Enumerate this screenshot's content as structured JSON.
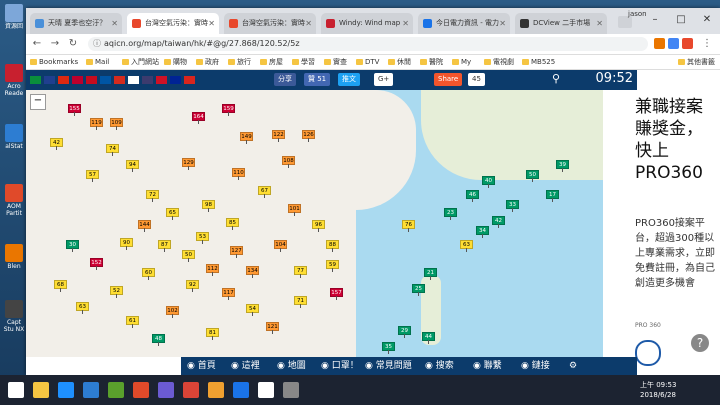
{
  "desktop": {
    "icons": [
      {
        "label": "資源回",
        "color": "#7da7d9"
      },
      {
        "label": "Acro Reade",
        "color": "#c8202f"
      },
      {
        "label": "alStat",
        "color": "#2d7dd2"
      },
      {
        "label": "AOM Partit",
        "color": "#e04a2a"
      },
      {
        "label": "Blen",
        "color": "#ea7600"
      },
      {
        "label": "Capt Stu NX",
        "color": "#444444"
      }
    ]
  },
  "browser": {
    "tabs": [
      {
        "label": "天晴 夏季也空汙？",
        "color": "#4a90d9",
        "active": false
      },
      {
        "label": "台灣空氣污染：實時",
        "color": "#e8482c",
        "active": true
      },
      {
        "label": "台灣空氣污染：實時",
        "color": "#e8482c",
        "active": false
      },
      {
        "label": "Windy: Wind map",
        "color": "#c8202f",
        "active": false
      },
      {
        "label": "今日電力資訊 - 電力",
        "color": "#1a73e8",
        "active": false
      },
      {
        "label": "DCView 二手市場",
        "color": "#333333",
        "active": false
      }
    ],
    "user": "jason",
    "url": "aqicn.org/map/taiwan/hk/#@g/27.868/120.52/5z",
    "bookmarks": [
      "Bookmarks",
      "Mail",
      "入門網站",
      "購物",
      "政府",
      "旅行",
      "房屋",
      "學習",
      "實查",
      "DTV",
      "休閒",
      "醫院",
      "My",
      "電視劇",
      "MB525",
      "其他書籤"
    ]
  },
  "site": {
    "share_label": "分享",
    "fb_label": "贊 51",
    "twitter_label": "推文",
    "gplus_label": "G+",
    "sharethis_label": "Share",
    "share_count": "45",
    "time": "09:52",
    "flags": [
      "#0a8f3c",
      "#1f3f8f",
      "#de2910",
      "#bc002d",
      "#c60b1e",
      "#0055a4",
      "#d52b1e",
      "#ffffff",
      "#3c3b6e",
      "#ce1126",
      "#002395",
      "#da251d"
    ]
  },
  "map": {
    "markers": [
      {
        "v": "155",
        "c": "r"
      },
      {
        "v": "119",
        "c": "o"
      },
      {
        "v": "109",
        "c": "o"
      },
      {
        "v": "42",
        "c": "y"
      },
      {
        "v": "164",
        "c": "r"
      },
      {
        "v": "159",
        "c": "r"
      },
      {
        "v": "122",
        "c": "o"
      },
      {
        "v": "149",
        "c": "o"
      },
      {
        "v": "126",
        "c": "o"
      },
      {
        "v": "74",
        "c": "y"
      },
      {
        "v": "94",
        "c": "y"
      },
      {
        "v": "57",
        "c": "y"
      },
      {
        "v": "129",
        "c": "o"
      },
      {
        "v": "110",
        "c": "o"
      },
      {
        "v": "108",
        "c": "o"
      },
      {
        "v": "144",
        "c": "o"
      },
      {
        "v": "90",
        "c": "y"
      },
      {
        "v": "87",
        "c": "y"
      },
      {
        "v": "50",
        "c": "y"
      },
      {
        "v": "53",
        "c": "y"
      },
      {
        "v": "117",
        "c": "o"
      },
      {
        "v": "134",
        "c": "o"
      },
      {
        "v": "157",
        "c": "r"
      },
      {
        "v": "152",
        "c": "r"
      },
      {
        "v": "102",
        "c": "o"
      },
      {
        "v": "121",
        "c": "o"
      },
      {
        "v": "81",
        "c": "y"
      },
      {
        "v": "68",
        "c": "y"
      },
      {
        "v": "63",
        "c": "y"
      },
      {
        "v": "30",
        "c": "g"
      },
      {
        "v": "21",
        "c": "g"
      },
      {
        "v": "25",
        "c": "g"
      },
      {
        "v": "76",
        "c": "y"
      },
      {
        "v": "63",
        "c": "y"
      },
      {
        "v": "34",
        "c": "g"
      },
      {
        "v": "42",
        "c": "g"
      },
      {
        "v": "23",
        "c": "g"
      },
      {
        "v": "46",
        "c": "g"
      },
      {
        "v": "33",
        "c": "g"
      },
      {
        "v": "17",
        "c": "g"
      },
      {
        "v": "50",
        "c": "g"
      },
      {
        "v": "39",
        "c": "g"
      },
      {
        "v": "40",
        "c": "g"
      },
      {
        "v": "72",
        "c": "y"
      },
      {
        "v": "65",
        "c": "y"
      },
      {
        "v": "98",
        "c": "y"
      },
      {
        "v": "85",
        "c": "y"
      },
      {
        "v": "67",
        "c": "y"
      },
      {
        "v": "101",
        "c": "o"
      },
      {
        "v": "96",
        "c": "y"
      },
      {
        "v": "88",
        "c": "y"
      },
      {
        "v": "60",
        "c": "y"
      },
      {
        "v": "112",
        "c": "o"
      },
      {
        "v": "104",
        "c": "o"
      },
      {
        "v": "77",
        "c": "y"
      },
      {
        "v": "59",
        "c": "y"
      },
      {
        "v": "92",
        "c": "y"
      },
      {
        "v": "127",
        "c": "o"
      },
      {
        "v": "54",
        "c": "y"
      },
      {
        "v": "71",
        "c": "y"
      },
      {
        "v": "35",
        "c": "g"
      },
      {
        "v": "29",
        "c": "g"
      },
      {
        "v": "44",
        "c": "g"
      },
      {
        "v": "52",
        "c": "y"
      },
      {
        "v": "61",
        "c": "y"
      },
      {
        "v": "48",
        "c": "g"
      }
    ]
  },
  "ad": {
    "headline": "兼職接案賺獎金，快上PRO360",
    "body": "PRO360接案平台，超過300種以上專業需求，立即免費註冊，為自己創造更多機會",
    "source": "PRO 360",
    "help": "?"
  },
  "footer": {
    "items": [
      "首頁",
      "這裡",
      "地圖",
      "口罩！",
      "常見問題",
      "搜索",
      "聯繫",
      "鏈接"
    ]
  },
  "taskbar": {
    "time": "上午 09:53",
    "date": "2018/6/28",
    "icons": [
      "#ffffff",
      "#f5c542",
      "#1e90ff",
      "#2d7dd2",
      "#5aa02c",
      "#e04a2a",
      "#6b5bd2",
      "#db4437",
      "#f0a030",
      "#1a73e8",
      "#ffffff",
      "#888888"
    ]
  }
}
